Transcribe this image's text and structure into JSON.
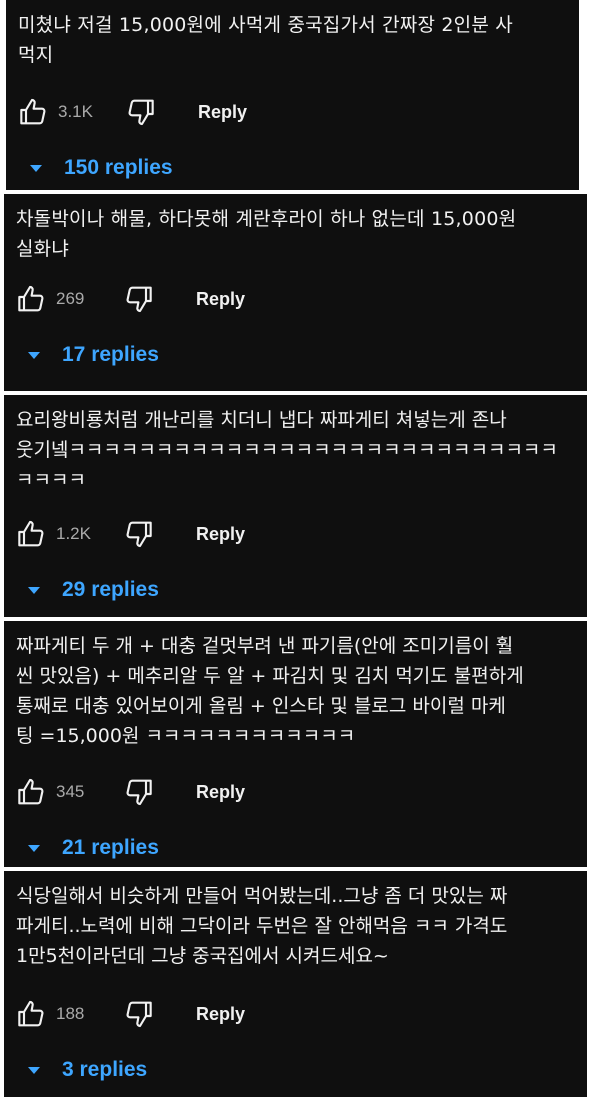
{
  "comments": [
    {
      "text": "미쳤냐 저걸 15,000원에 사먹게 중국집가서 간짜장 2인분 사\n먹지",
      "likes": "3.1K",
      "reply_label": "Reply",
      "replies_label": "150 replies"
    },
    {
      "text": "차돌박이나 해물, 하다못해 계란후라이 하나 없는데 15,000원\n실화냐",
      "likes": "269",
      "reply_label": "Reply",
      "replies_label": "17 replies"
    },
    {
      "text": "요리왕비룡처럼 개난리를 치더니 냅다 짜파게티 쳐넣는게 존나\n웃기넼ㅋㅋㅋㅋㅋㅋㅋㅋㅋㅋㅋㅋㅋㅋㅋㅋㅋㅋㅋㅋㅋㅋㅋㅋㅋㅋㅋㅋ\nㅋㅋㅋㅋ",
      "likes": "1.2K",
      "reply_label": "Reply",
      "replies_label": "29 replies"
    },
    {
      "text": "짜파게티 두 개 + 대충 겉멋부려 낸 파기름(안에 조미기름이 훨\n씬 맛있음) + 메추리알 두 알 + 파김치 및 김치 먹기도 불편하게\n통째로 대충 있어보이게 올림 + 인스타 및 블로그 바이럴 마케\n팅 =15,000원 ㅋㅋㅋㅋㅋㅋㅋㅋㅋㅋㅋㅋ",
      "likes": "345",
      "reply_label": "Reply",
      "replies_label": "21 replies"
    },
    {
      "text": "식당일해서 비슷하게 만들어 먹어봤는데..그냥 좀 더 맛있는 짜\n파게티..노력에 비해 그닥이라 두번은 잘 안해먹음 ㅋㅋ 가격도\n1만5천이라던데 그냥 중국집에서 시켜드세요~",
      "likes": "188",
      "reply_label": "Reply",
      "replies_label": "3 replies"
    }
  ],
  "icons": {
    "like": "thumbs-up-outline-icon",
    "dislike": "thumbs-down-outline-icon",
    "expand": "caret-down-icon"
  },
  "colors": {
    "background": "#0f0f0f",
    "text": "#f1f1f1",
    "secondary_text": "#aaaaaa",
    "link": "#3ea6ff",
    "page": "#ffffff"
  }
}
